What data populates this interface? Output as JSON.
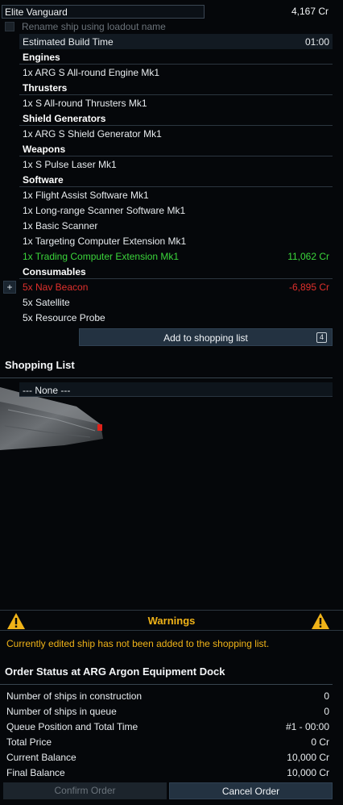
{
  "loadout": {
    "ship_name": "Elite Vanguard",
    "ship_price": "4,167 Cr",
    "rename_label": "Rename ship using loadout name",
    "build_time_label": "Estimated Build Time",
    "build_time_value": "01:00"
  },
  "sections": {
    "engines": "Engines",
    "engine_item": "1x ARG S All-round Engine Mk1",
    "thrusters": "Thrusters",
    "thruster_item": "1x S All-round Thrusters Mk1",
    "shields": "Shield Generators",
    "shield_item": "1x ARG S Shield Generator Mk1",
    "weapons": "Weapons",
    "weapon_item": "1x S Pulse Laser Mk1",
    "software": "Software",
    "software_items": [
      "1x Flight Assist Software Mk1",
      "1x Long-range Scanner Software Mk1",
      "1x Basic Scanner",
      "1x Targeting Computer Extension Mk1"
    ],
    "trading_item": "1x Trading Computer Extension Mk1",
    "trading_price": "11,062 Cr",
    "consumables": "Consumables",
    "nav_beacon": "5x Nav Beacon",
    "nav_beacon_price": "-6,895 Cr",
    "satellite": "5x Satellite",
    "resource_probe": "5x Resource Probe",
    "plus_label": "+"
  },
  "shopping": {
    "add_button": "Add to shopping list",
    "key_hint": "4",
    "title": "Shopping List",
    "none_label": "--- None ---"
  },
  "warnings": {
    "title": "Warnings",
    "message": "Currently edited ship has not been added to the shopping list."
  },
  "order": {
    "title": "Order Status at ARG Argon Equipment Dock",
    "rows": [
      {
        "label": "Number of ships in construction",
        "value": "0"
      },
      {
        "label": "Number of ships in queue",
        "value": "0"
      },
      {
        "label": "Queue Position and Total Time",
        "value": "#1 - 00:00"
      },
      {
        "label": "Total Price",
        "value": "0 Cr"
      },
      {
        "label": "Current Balance",
        "value": "10,000 Cr"
      },
      {
        "label": "Final Balance",
        "value": "10,000 Cr"
      }
    ],
    "confirm_label": "Confirm Order",
    "cancel_label": "Cancel Order"
  },
  "colors": {
    "warning": "#f0b318",
    "positive": "#3bd63b",
    "negative": "#e0302c",
    "button": "#233241"
  }
}
